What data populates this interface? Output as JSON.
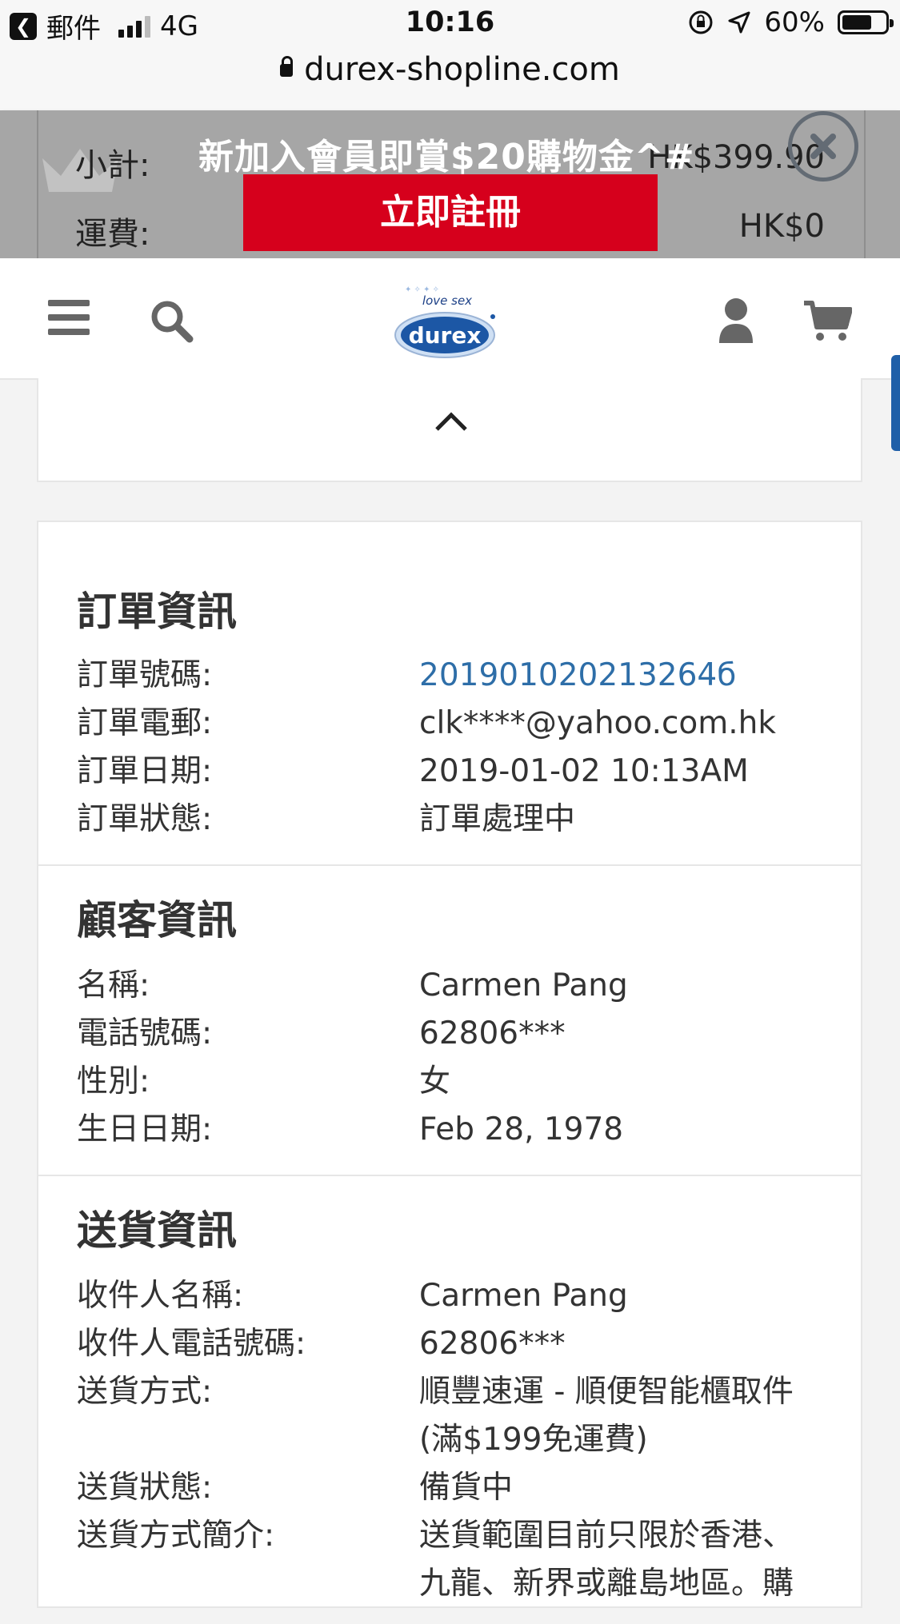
{
  "status_bar": {
    "back_app": "郵件",
    "network": "4G",
    "time": "10:16",
    "battery": "60%"
  },
  "browser": {
    "url": "durex-shopline.com"
  },
  "promo": {
    "subtotal_label": "小計:",
    "subtotal_value": "HK$399.90",
    "shipping_label": "運費:",
    "shipping_value": "HK$0",
    "headline": "新加入會員即賞$20購物金^#",
    "register_button": "立即註冊"
  },
  "header": {
    "logo_tagline": "love sex",
    "logo_brand": "durex"
  },
  "order_info": {
    "title": "訂單資訊",
    "rows": [
      {
        "label": "訂單號碼:",
        "value": "201901020213264б"
      },
      {
        "label": "訂單電郵:",
        "value": "clk****@yahoo.com.hk"
      },
      {
        "label": "訂單日期:",
        "value": "2019-01-02 10:13AM"
      },
      {
        "label": "訂單狀態:",
        "value": "訂單處理中"
      }
    ]
  },
  "customer_info": {
    "title": "顧客資訊",
    "rows": [
      {
        "label": "名稱:",
        "value": "Carmen Pang"
      },
      {
        "label": "電話號碼:",
        "value": "62806***"
      },
      {
        "label": "性別:",
        "value": "女"
      },
      {
        "label": "生日日期:",
        "value": "Feb 28, 1978"
      }
    ]
  },
  "delivery_info": {
    "title": "送貨資訊",
    "rows": [
      {
        "label": "收件人名稱:",
        "value": "Carmen Pang"
      },
      {
        "label": "收件人電話號碼:",
        "value": "62806***"
      },
      {
        "label": "送貨方式:",
        "value": "順豐速運 - 順便智能櫃取件",
        "value2": "(滿$199免運費)"
      },
      {
        "label": "送貨狀態:",
        "value": "備貨中"
      },
      {
        "label": "送貨方式簡介:",
        "value": "送貨範圍目前只限於香港、",
        "value2": "九龍、新界或離島地區。購"
      }
    ]
  }
}
